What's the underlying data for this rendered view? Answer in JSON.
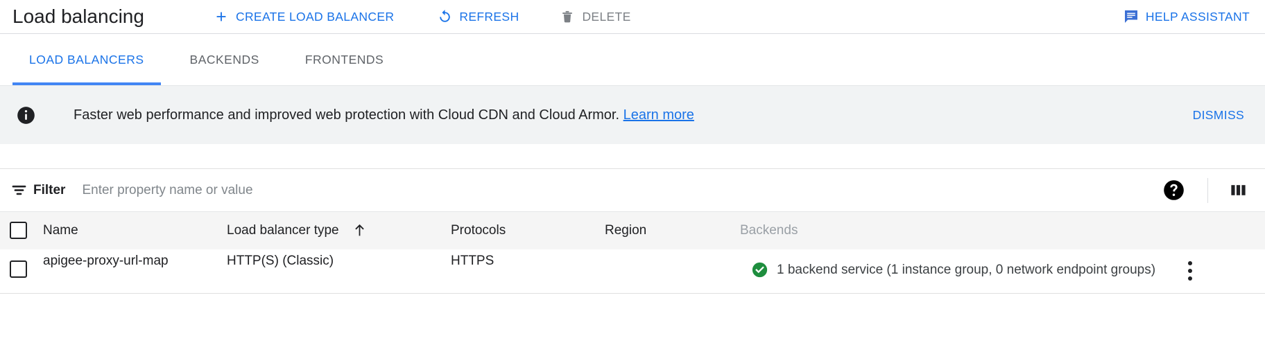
{
  "toolbar": {
    "title": "Load balancing",
    "actions": [
      {
        "label": "CREATE LOAD BALANCER",
        "icon": "plus-icon",
        "state": "enabled"
      },
      {
        "label": "REFRESH",
        "icon": "refresh-icon",
        "state": "enabled"
      },
      {
        "label": "DELETE",
        "icon": "trash-icon",
        "state": "disabled"
      }
    ],
    "help_assistant": {
      "label": "HELP ASSISTANT",
      "icon": "chat-message-icon"
    }
  },
  "tabs": [
    {
      "label": "LOAD BALANCERS",
      "active": true
    },
    {
      "label": "BACKENDS",
      "active": false
    },
    {
      "label": "FRONTENDS",
      "active": false
    }
  ],
  "banner": {
    "icon": "info-icon",
    "text": "Faster web performance and improved web protection with Cloud CDN and Cloud Armor.",
    "link_label": "Learn more",
    "dismiss_label": "DISMISS"
  },
  "filter": {
    "icon": "filter-icon",
    "label": "Filter",
    "placeholder": "Enter property name or value",
    "value": "",
    "help_icon": "help-circle-icon",
    "columns_icon": "column-display-options-icon"
  },
  "table": {
    "columns": [
      {
        "key": "name",
        "label": "Name",
        "muted": false,
        "sorted": false
      },
      {
        "key": "type",
        "label": "Load balancer type",
        "muted": false,
        "sorted": true,
        "sort_direction": "asc"
      },
      {
        "key": "protocols",
        "label": "Protocols",
        "muted": false,
        "sorted": false
      },
      {
        "key": "region",
        "label": "Region",
        "muted": false,
        "sorted": false
      },
      {
        "key": "backends",
        "label": "Backends",
        "muted": true,
        "sorted": false
      }
    ],
    "rows": [
      {
        "selected": false,
        "name": "apigee-proxy-url-map",
        "type": "HTTP(S) (Classic)",
        "protocols": "HTTPS",
        "region": "",
        "backends_status_icon": "check-circle-icon",
        "backends": "1 backend service (1 instance group, 0 network endpoint groups)"
      }
    ]
  },
  "colors": {
    "accent_blue": "#1a73e8",
    "tab_underline": "#4285f4",
    "disabled_grey": "#7c8085",
    "success_green": "#1e8e3e",
    "banner_bg": "#f1f3f4",
    "header_bg": "#f5f5f5"
  }
}
